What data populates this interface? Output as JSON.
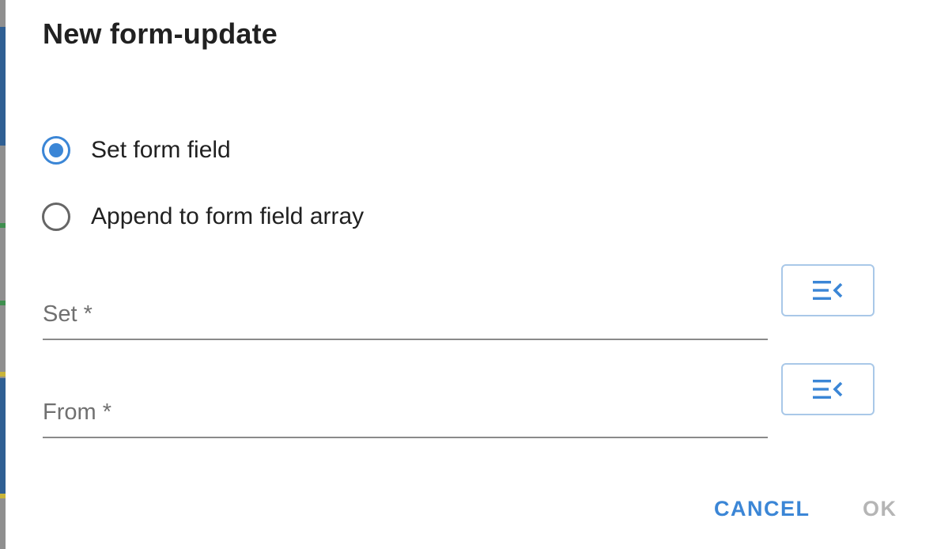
{
  "dialog": {
    "title": "New form-update",
    "options": [
      {
        "label": "Set form field",
        "selected": true
      },
      {
        "label": "Append to form field array",
        "selected": false
      }
    ],
    "fields": {
      "set": {
        "label": "Set *",
        "value": ""
      },
      "from": {
        "label": "From *",
        "value": ""
      }
    },
    "picker_icon": "list-collapse-icon",
    "actions": {
      "cancel": "CANCEL",
      "ok": "OK"
    }
  },
  "colors": {
    "accent": "#3b86d6",
    "picker_border": "#a9c8e8",
    "disabled_text": "#b5b5b5",
    "title_text": "#212121",
    "label_text": "#707070",
    "backdrop": "#8f8f8f"
  }
}
